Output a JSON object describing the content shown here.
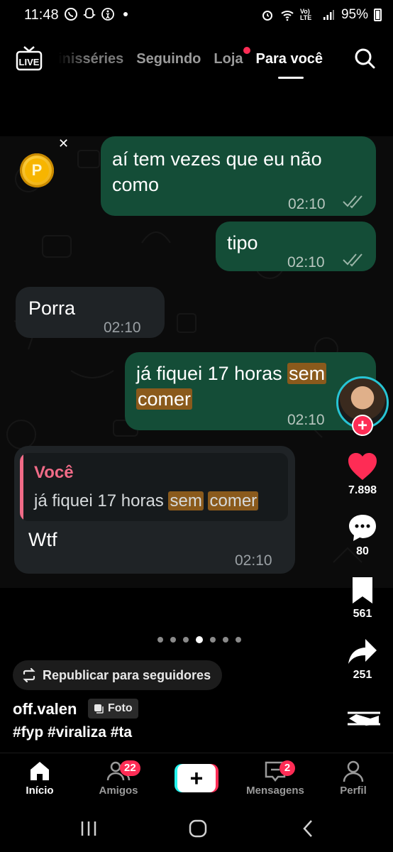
{
  "status_bar": {
    "time": "11:48",
    "battery": "95%",
    "network": "Vo) LTE"
  },
  "top_nav": {
    "tabs": [
      {
        "label": "Minisséries",
        "visible_label": "inisséries",
        "active": false
      },
      {
        "label": "Seguindo",
        "active": false
      },
      {
        "label": "Loja",
        "active": false,
        "has_dot": true
      },
      {
        "label": "Para você",
        "active": true
      }
    ]
  },
  "chat": {
    "messages": [
      {
        "direction": "out",
        "text": "aí tem vezes que eu não como",
        "time": "02:10",
        "read": true
      },
      {
        "direction": "out",
        "text": "tipo",
        "time": "02:10",
        "read": true
      },
      {
        "direction": "in",
        "text": "Porra",
        "time": "02:10"
      },
      {
        "direction": "out",
        "text_before": "já fiquei 17 horas ",
        "highlight_1": "sem",
        "highlight_2": "comer",
        "time": "02:10",
        "read": true
      },
      {
        "direction": "in",
        "quote_author": "Você",
        "quote_before": "já fiquei 17 horas ",
        "quote_highlight_1": "sem",
        "quote_highlight_2": "comer",
        "text": "Wtf",
        "time": "02:10"
      }
    ]
  },
  "rail": {
    "likes": "7.898",
    "comments": "80",
    "saves": "561",
    "shares": "251"
  },
  "carousel": {
    "total": 7,
    "active_index": 3
  },
  "post": {
    "repost_label": "Republicar para seguidores",
    "username": "off.valen",
    "type_badge": "Foto",
    "hashtags": "#fyp #viraliza #ta"
  },
  "bottom_nav": {
    "items": [
      {
        "label": "Início",
        "active": true
      },
      {
        "label": "Amigos",
        "badge": "22"
      },
      {
        "label": "Mensagens",
        "badge": "2"
      },
      {
        "label": "Perfil"
      }
    ]
  },
  "colors": {
    "accent": "#fe2c55",
    "outgoing_bubble": "#144d37",
    "incoming_bubble": "#1f2326",
    "highlight": "#8a5a1c",
    "quote_author": "#f06b87"
  }
}
